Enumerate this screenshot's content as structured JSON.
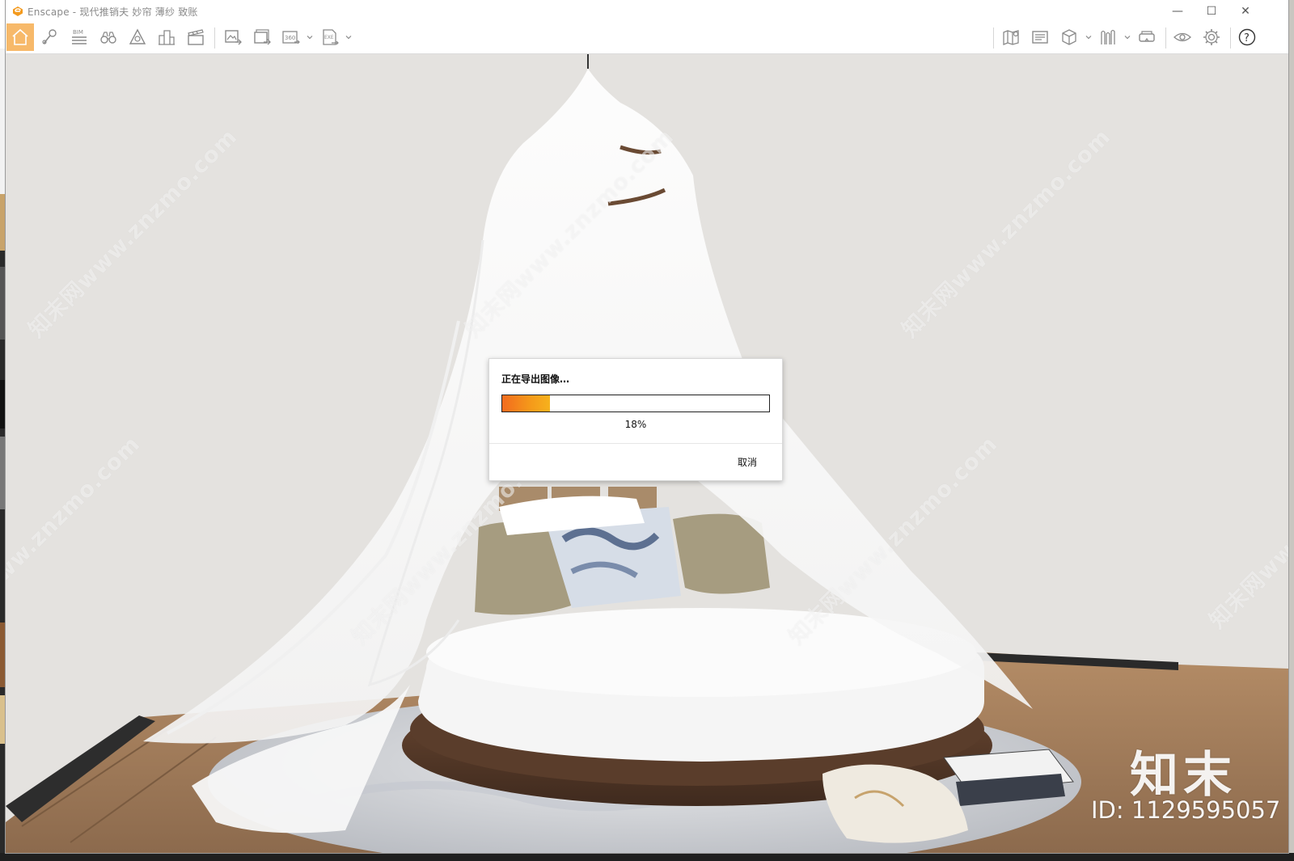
{
  "window": {
    "title": "Enscape - 现代推销夫 妙帘 薄纱 致账",
    "minimize_symbol": "—",
    "maximize_symbol": "☐",
    "close_symbol": "✕"
  },
  "toolbar": {
    "left_buttons": [
      {
        "name": "home-icon",
        "active": true
      },
      {
        "name": "walk-mode-icon"
      },
      {
        "name": "bim-icon",
        "label": "BIM"
      },
      {
        "name": "binoculars-icon"
      },
      {
        "name": "visual-settings-icon"
      },
      {
        "name": "buildings-icon"
      },
      {
        "name": "video-editor-icon"
      }
    ],
    "export_buttons": [
      {
        "name": "render-image-icon"
      },
      {
        "name": "batch-render-icon"
      },
      {
        "name": "panorama-360-icon",
        "label": "360"
      },
      {
        "name": "exe-export-icon",
        "label": "EXE"
      }
    ],
    "right_buttons": [
      {
        "name": "map-icon"
      },
      {
        "name": "presentation-icon"
      },
      {
        "name": "cube-view-icon"
      },
      {
        "name": "asset-library-icon"
      },
      {
        "name": "vr-headset-icon"
      },
      {
        "name": "eye-icon"
      },
      {
        "name": "settings-icon"
      },
      {
        "name": "help-icon",
        "label": "?"
      }
    ]
  },
  "dialog": {
    "title": "正在导出图像…",
    "progress": 0.18,
    "progress_text": "18%",
    "cancel_label": "取消"
  },
  "watermark": {
    "text": "知末网www.znzmo.com",
    "brand": "知末",
    "id_text": "ID: 1129595057"
  },
  "colors": {
    "accent": "#f7b96a",
    "progress_start": "#f26b1e",
    "progress_end": "#f6b21d",
    "canvas_bg": "#e3e1de"
  }
}
